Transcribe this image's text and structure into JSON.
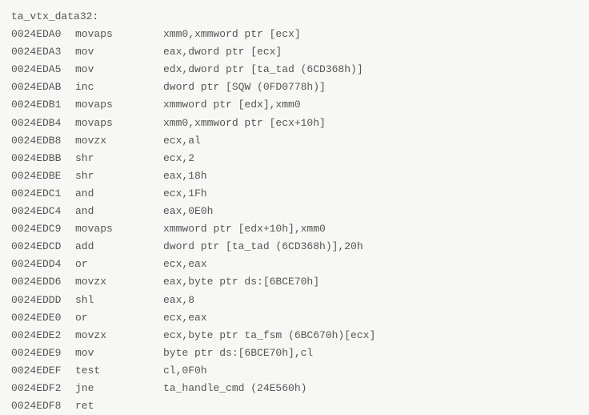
{
  "label": "ta_vtx_data32:",
  "lines": [
    {
      "addr": "0024EDA0",
      "mnemonic": "movaps",
      "operands": "xmm0,xmmword ptr [ecx]"
    },
    {
      "addr": "0024EDA3",
      "mnemonic": "mov",
      "operands": "eax,dword ptr [ecx]"
    },
    {
      "addr": "0024EDA5",
      "mnemonic": "mov",
      "operands": "edx,dword ptr [ta_tad (6CD368h)]"
    },
    {
      "addr": "0024EDAB",
      "mnemonic": "inc",
      "operands": "dword ptr [SQW (0FD0778h)]"
    },
    {
      "addr": "0024EDB1",
      "mnemonic": "movaps",
      "operands": "xmmword ptr [edx],xmm0"
    },
    {
      "addr": "0024EDB4",
      "mnemonic": "movaps",
      "operands": "xmm0,xmmword ptr [ecx+10h]"
    },
    {
      "addr": "0024EDB8",
      "mnemonic": "movzx",
      "operands": "ecx,al"
    },
    {
      "addr": "0024EDBB",
      "mnemonic": "shr",
      "operands": "ecx,2"
    },
    {
      "addr": "0024EDBE",
      "mnemonic": "shr",
      "operands": "eax,18h"
    },
    {
      "addr": "0024EDC1",
      "mnemonic": "and",
      "operands": "ecx,1Fh"
    },
    {
      "addr": "0024EDC4",
      "mnemonic": "and",
      "operands": "eax,0E0h"
    },
    {
      "addr": "0024EDC9",
      "mnemonic": "movaps",
      "operands": "xmmword ptr [edx+10h],xmm0"
    },
    {
      "addr": "0024EDCD",
      "mnemonic": "add",
      "operands": "dword ptr [ta_tad (6CD368h)],20h"
    },
    {
      "addr": "0024EDD4",
      "mnemonic": "or",
      "operands": "ecx,eax"
    },
    {
      "addr": "0024EDD6",
      "mnemonic": "movzx",
      "operands": "eax,byte ptr ds:[6BCE70h]"
    },
    {
      "addr": "0024EDDD",
      "mnemonic": "shl",
      "operands": "eax,8"
    },
    {
      "addr": "0024EDE0",
      "mnemonic": "or",
      "operands": "ecx,eax"
    },
    {
      "addr": "0024EDE2",
      "mnemonic": "movzx",
      "operands": "ecx,byte ptr ta_fsm (6BC670h)[ecx]"
    },
    {
      "addr": "0024EDE9",
      "mnemonic": "mov",
      "operands": "byte ptr ds:[6BCE70h],cl"
    },
    {
      "addr": "0024EDEF",
      "mnemonic": "test",
      "operands": "cl,0F0h"
    },
    {
      "addr": "0024EDF2",
      "mnemonic": "jne",
      "operands": "ta_handle_cmd (24E560h)"
    },
    {
      "addr": "0024EDF8",
      "mnemonic": "ret",
      "operands": ""
    }
  ]
}
